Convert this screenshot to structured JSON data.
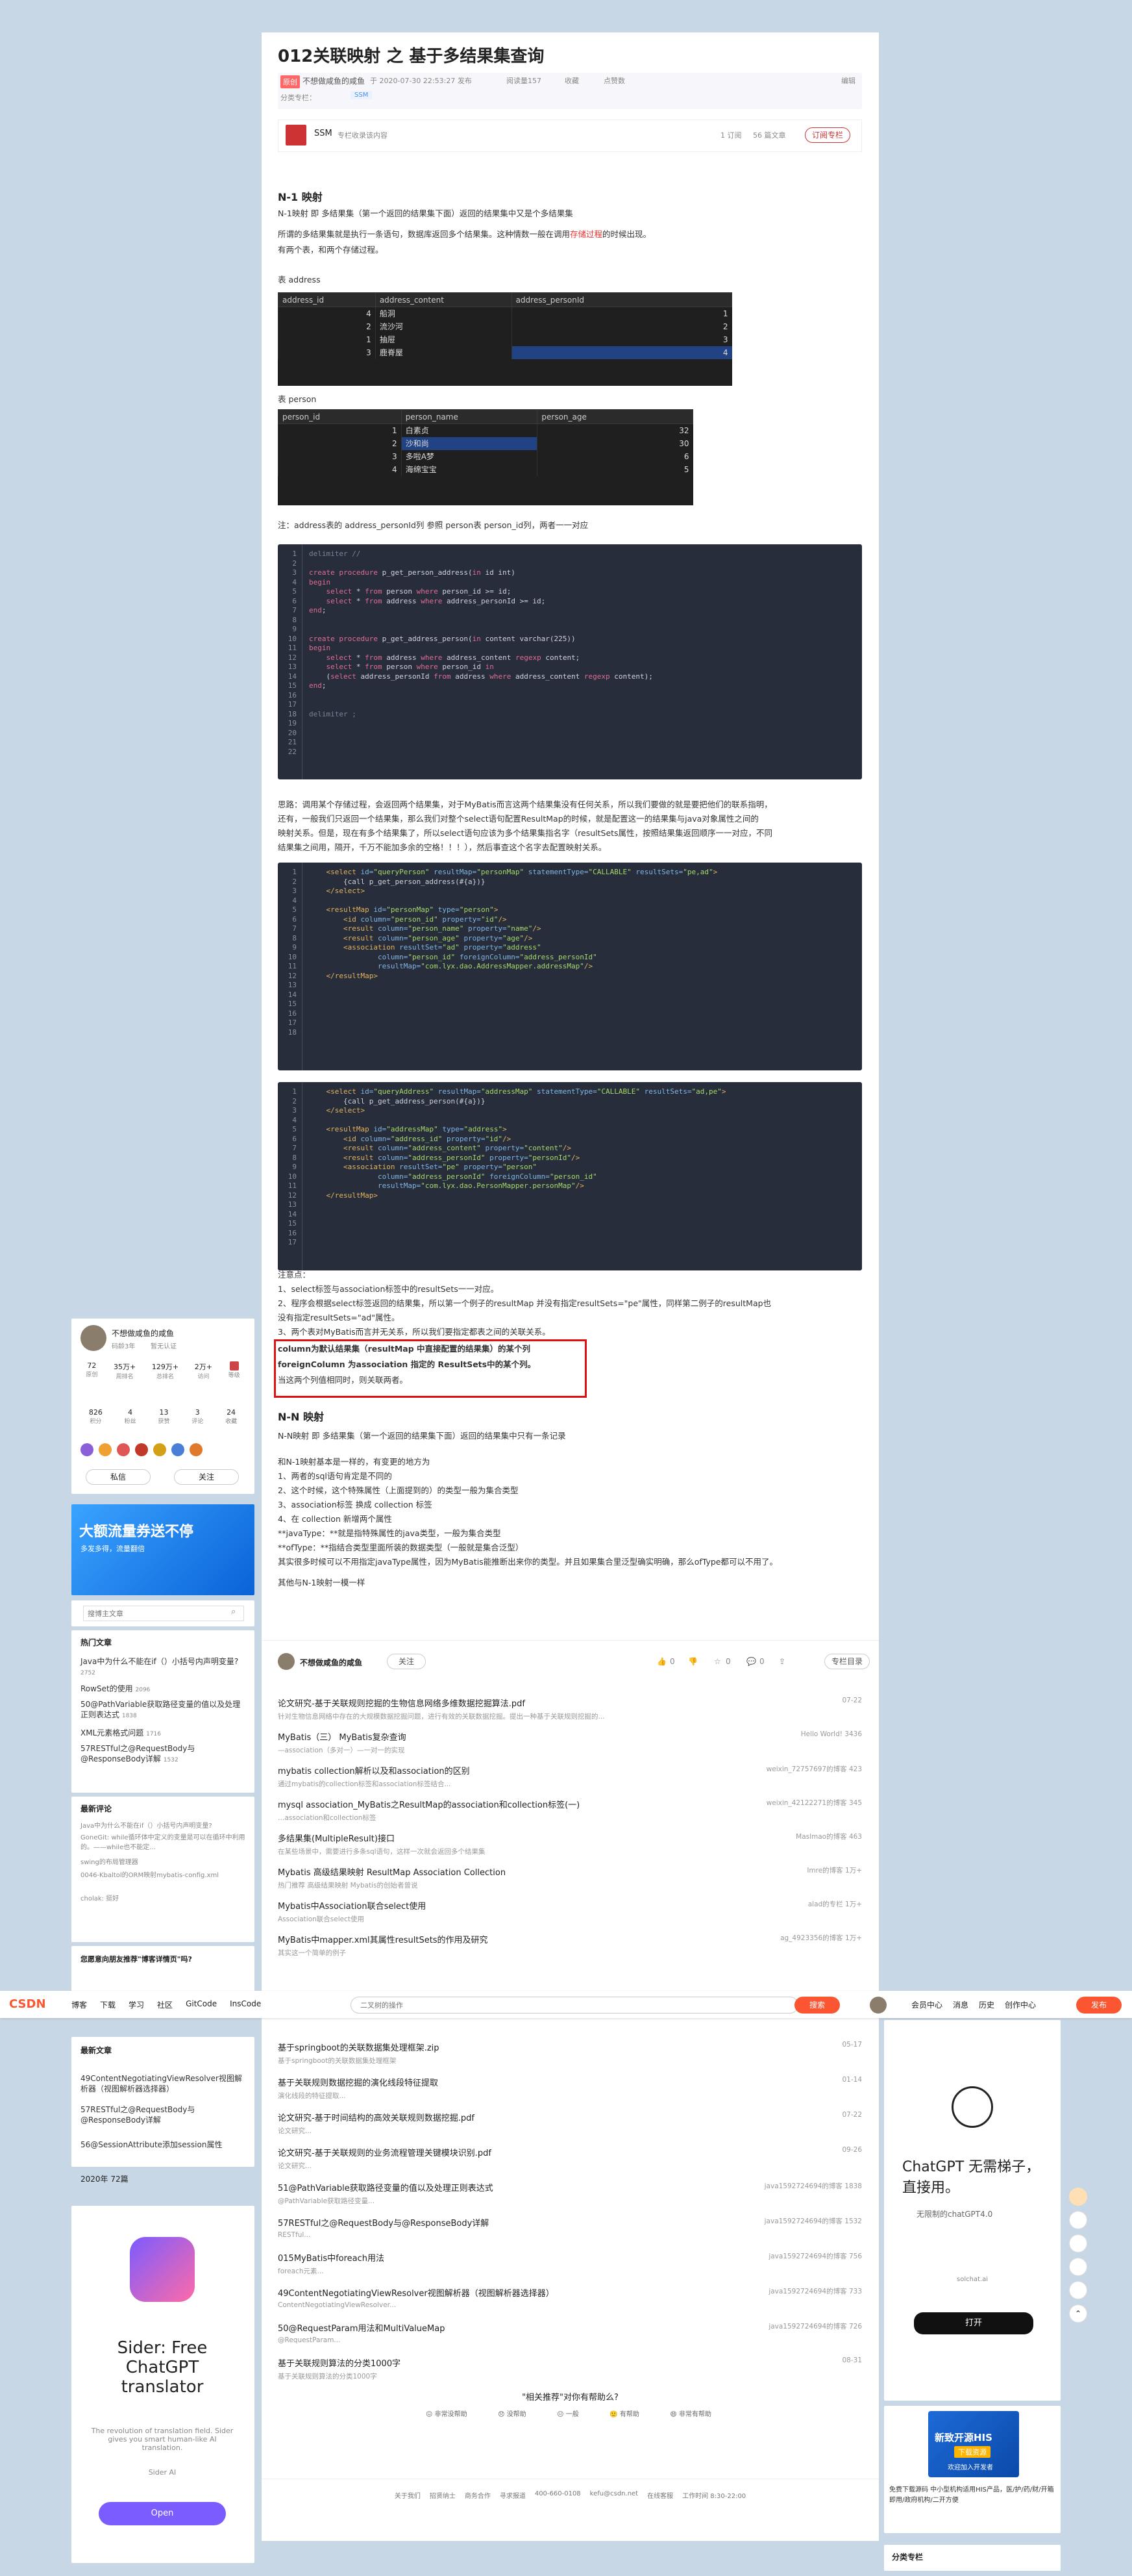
{
  "article": {
    "title": "012关联映射 之 基于多结果集查询",
    "original_tag": "原创",
    "author": "不想做咸鱼的咸鱼",
    "date": "于 2020-07-30 22:53:27 发布",
    "views": "阅读量157",
    "collect": "收藏",
    "likes": "点赞数",
    "edit": "编辑",
    "category_label": "分类专栏：",
    "category": "SSM",
    "copyright": "版权",
    "column": {
      "name": "SSM",
      "desc": "专栏收录该内容",
      "count_articles": "1 订阅",
      "count_sub": "56 篇文章",
      "subscribe": "订阅专栏"
    },
    "h_n1": "N-1 映射",
    "p1": "N-1映射 即 多结果集（第一个返回的结果集下面）返回的结果集中又是个多结果集",
    "p2a": "所谓的多结果集就是执行一条语句，数据库返回多个结果集。这种情数一般在调用",
    "p2link": "存储过程",
    "p2b": "的时候出现。",
    "p3": "有两个表，和两个存储过程。",
    "t_address_label": "表 address",
    "t_person_label": "表 person",
    "note_fk": "注：address表的 address_personId列 参照 person表 person_id列，两者一一对应",
    "p_after_code1": "思路：调用某个存储过程，会返回两个结果集，对于MyBatis而言这两个结果集没有任何关系，所以我们要做的就是要把他们的联系指明，",
    "p_after_code1b": "还有，一般我们只返回一个结果集，那么我们对整个select语句配置ResultMap的时候，就是配置这一的结果集与java对象属性之间的",
    "p_after_code1c": "映射关系。但是，现在有多个结果集了，所以select语句应该为多个结果集指名字（resultSets属性，按照结果集返回顺序一一对应，不同",
    "p_after_code1d": "结果集之间用，隔开，千万不能加多余的空格！！！），然后事查这个名字去配置映射关系。",
    "notes_title": "注意点：",
    "notes": [
      "1、select标签与association标签中的resultSets一一对应。",
      "2、程序会根据select标签返回的结果集，所以第一个例子的resultMap 并没有指定resultSets=\"pe\"属性，同样第二例子的resultMap也",
      "没有指定resultSets=\"ad\"属性。",
      "3、两个表对MyBatis而言并无关系，所以我们要指定都表之间的关联关系。"
    ],
    "boxed": [
      "column为默认结果集（resultMap 中直接配置的结果集）的某个列",
      "foreignColumn 为association 指定的 ResultSets中的某个列。",
      "当这两个列值相同时，则关联两者。"
    ],
    "h_nn": "N-N 映射",
    "pn1": "N-N映射 即 多结果集（第一个返回的结果集下面）返回的结果集中只有一条记录",
    "pn2": "和N-1映射基本是一样的，有变更的地方为",
    "pn_list": [
      "1、两者的sql语句肯定是不同的",
      "2、这个时候，这个特殊属性（上面提到的）的类型一般为集合类型",
      "3、association标签 换成 collection 标签",
      "4、在 collection 新增两个属性",
      "**javaType：**就是指特殊属性的java类型，一般为集合类型",
      "**ofType：**指结合类型里面所装的数据类型（一般就是集合泛型）"
    ],
    "pn3": "其实很多时候可以不用指定javaType属性，因为MyBatis能推断出来你的类型。并且如果集合里泛型确实明确，那么ofType都可以不用了。",
    "pn4": "其他与N-1映射一模一样",
    "bottom_author": "不想做咸鱼的咸鱼",
    "follow": "关注",
    "bottom_stats": [
      "0",
      "0",
      "0"
    ],
    "bottom_col": "专栏目录"
  },
  "table_address": {
    "headers": [
      "address_id",
      "address_content",
      "address_personId"
    ],
    "rows": [
      [
        "4",
        "船洞",
        "1"
      ],
      [
        "2",
        "流沙河",
        "2"
      ],
      [
        "1",
        "抽屉",
        "3"
      ],
      [
        "3",
        "鹿脊屋",
        "4"
      ]
    ]
  },
  "table_person": {
    "headers": [
      "person_id",
      "person_name",
      "person_age"
    ],
    "rows": [
      [
        "1",
        "白素贞",
        "32"
      ],
      [
        "2",
        "沙和尚",
        "30"
      ],
      [
        "3",
        "多啦A梦",
        "6"
      ],
      [
        "4",
        "海绵宝宝",
        "5"
      ]
    ]
  },
  "left": {
    "user": "不想做咸鱼的咸鱼",
    "years": "码龄3年",
    "verified": "暂无认证",
    "stats": [
      [
        "72",
        "原创"
      ],
      [
        "35万+",
        "周排名"
      ],
      [
        "129万+",
        "总排名"
      ],
      [
        "2万+",
        "访问"
      ],
      [
        "",
        "等级"
      ]
    ],
    "stats2": [
      [
        "826",
        "积分"
      ],
      [
        "4",
        "粉丝"
      ],
      [
        "13",
        "获赞"
      ],
      [
        "3",
        "评论"
      ],
      [
        "24",
        "收藏"
      ]
    ],
    "private": "私信",
    "follow": "关注",
    "ad_title": "大额流量券送不停",
    "ad_sub": "多发多得，流量翻倍",
    "search_placeholder": "搜博主文章",
    "hot_title": "热门文章",
    "hot": [
      [
        "Java中为什么不能在if（）小括号内声明变量?",
        "2752"
      ],
      [
        "RowSet的使用",
        "2096"
      ],
      [
        "50@PathVariable获取路径变量的值以及处理正则表达式",
        "1838"
      ],
      [
        "XML元素格式问题",
        "1716"
      ],
      [
        "57RESTful之@RequestBody与@ResponseBody详解",
        "1532"
      ]
    ],
    "comment_title": "最新评论",
    "comments": [
      "Java中为什么不能在if（）小括号内声明变量?",
      "GoneGit: while循环体中定义的变量是可以在循环中利用的。——while也不能定...",
      "swing的布局管理器",
      "0046-Kbaltol的ORM映射mybatis-config.xml",
      "cholak: 挺好"
    ],
    "fav_title": "您愿意向朋友推荐\"博客详情页\"吗?",
    "recent_title": "最新文章",
    "recent": [
      "49ContentNegotiatingViewResolver视图解析器（视图解析器选择器）",
      "57RESTful之@RequestBody与@ResponseBody详解",
      "56@SessionAttribute添加session属性"
    ],
    "archive": "2020年",
    "archive_count": "72篇",
    "sider_title": "Sider: Free ChatGPT translator",
    "sider_desc": "The revolution of translation field. Sider gives you smart human-like AI translation.",
    "sider_brand": "Sider AI",
    "sider_btn": "Open"
  },
  "toolbar": {
    "logo": "CSDN",
    "nav": [
      "博客",
      "下载",
      "学习",
      "社区",
      "GitCode",
      "InsCode"
    ],
    "search_placeholder": "二叉树的操作",
    "search_btn": "搜索",
    "right": [
      "会员中心",
      "消息",
      "历史",
      "创作中心"
    ],
    "publish": "发布"
  },
  "recommend": [
    [
      "论文研究-基于关联规则挖掘的生物信息网络多维数据挖掘算法.pdf",
      "针对生物信息网络中存在的大规模数据挖掘问题，进行有效的关联数据挖掘。提出一种基于关联规则挖掘的...",
      "07-22"
    ],
    [
      "MyBatis（三） MyBatis复杂查询",
      "—association（多对一）—一对一的实现",
      "Hello World!  3436"
    ],
    [
      "mybatis collection解析以及和association的区别",
      "通过mybatis的collection标签和association标签结合...",
      "weixin_72757697的博客  423"
    ],
    [
      "mysql association_MyBatis之ResultMap的association和collection标签(一)",
      "…association和collection标签",
      "weixin_42122271的博客  345"
    ],
    [
      "多结果集(MultipleResult)接口",
      "在某些场景中，需要进行多条sql语句，这样一次就会返回多个结果集",
      "Maslmao的博客  463"
    ],
    [
      "Mybatis 高级结果映射 ResultMap Association Collection",
      "热门推荐  高级结果映射 Mybatis的创始者曾说",
      "Imre的博客  1万+"
    ],
    [
      "Mybatis中Association联合select使用",
      "Association联合select使用",
      "alad的专栏  1万+"
    ],
    [
      "MyBatis中mapper.xml其属性resultSets的作用及研究",
      "其实这一个简单的例子",
      "ag_4923356的博客  1万+"
    ],
    [
      "基于springboot的关联数据集处理框架.zip",
      "基于springboot的关联数据集处理框架",
      "05-17"
    ],
    [
      "基于关联规则数据挖掘的演化线段特征提取",
      "演化线段的特征提取...",
      "01-14"
    ],
    [
      "论文研究-基于时间结构的高效关联规则数据挖掘.pdf",
      "论文研究...",
      "07-22"
    ],
    [
      "论文研究-基于关联规则的业务流程管理关键模块识别.pdf",
      "论文研究...",
      "09-26"
    ],
    [
      "51@PathVariable获取路径变量的值以及处理正则表达式",
      "@PathVariable获取路径变量...",
      "java1592724694的博客  1838"
    ],
    [
      "57RESTful之@RequestBody与@ResponseBody详解",
      "RESTful...",
      "java1592724694的博客  1532"
    ],
    [
      "015MyBatis中foreach用法",
      "foreach元素...",
      "java1592724694的博客  756"
    ],
    [
      "49ContentNegotiatingViewResolver视图解析器（视图解析器选择器）",
      "ContentNegotiatingViewResolver...",
      "java1592724694的博客  733"
    ],
    [
      "50@RequestParam用法和MultiValueMap",
      "@RequestParam...",
      "java1592724694的博客  726"
    ],
    [
      "基于关联规则算法的分类1000字",
      "基于关联规则算法的分类1000字",
      "08-31"
    ]
  ],
  "feedback": {
    "title": "\"相关推荐\"对你有帮助么?",
    "opts": [
      "非常没帮助",
      "没帮助",
      "一般",
      "有帮助",
      "非常有帮助"
    ]
  },
  "footer": [
    "关于我们",
    "招贤纳士",
    "商务合作",
    "寻求报道",
    "400-660-0108",
    "kefu@csdn.net",
    "在线客服",
    "工作时间 8:30-22:00"
  ],
  "right": {
    "chatgpt_title": "ChatGPT 无需梯子，直接用。",
    "chatgpt_sub": "无限制的chatGPT4.0",
    "chatgpt_site": "solchat.ai",
    "chatgpt_btn": "打开",
    "his_title": "新致开源HIS",
    "his_sub": "下载资源",
    "his_sub2": "欢迎加入开发者",
    "his_text": "免费下载源码 中小型机构适用HIS产品，医/护/药/财/开箱即用/政府机构/二开方便",
    "cat_title": "分类专栏"
  }
}
